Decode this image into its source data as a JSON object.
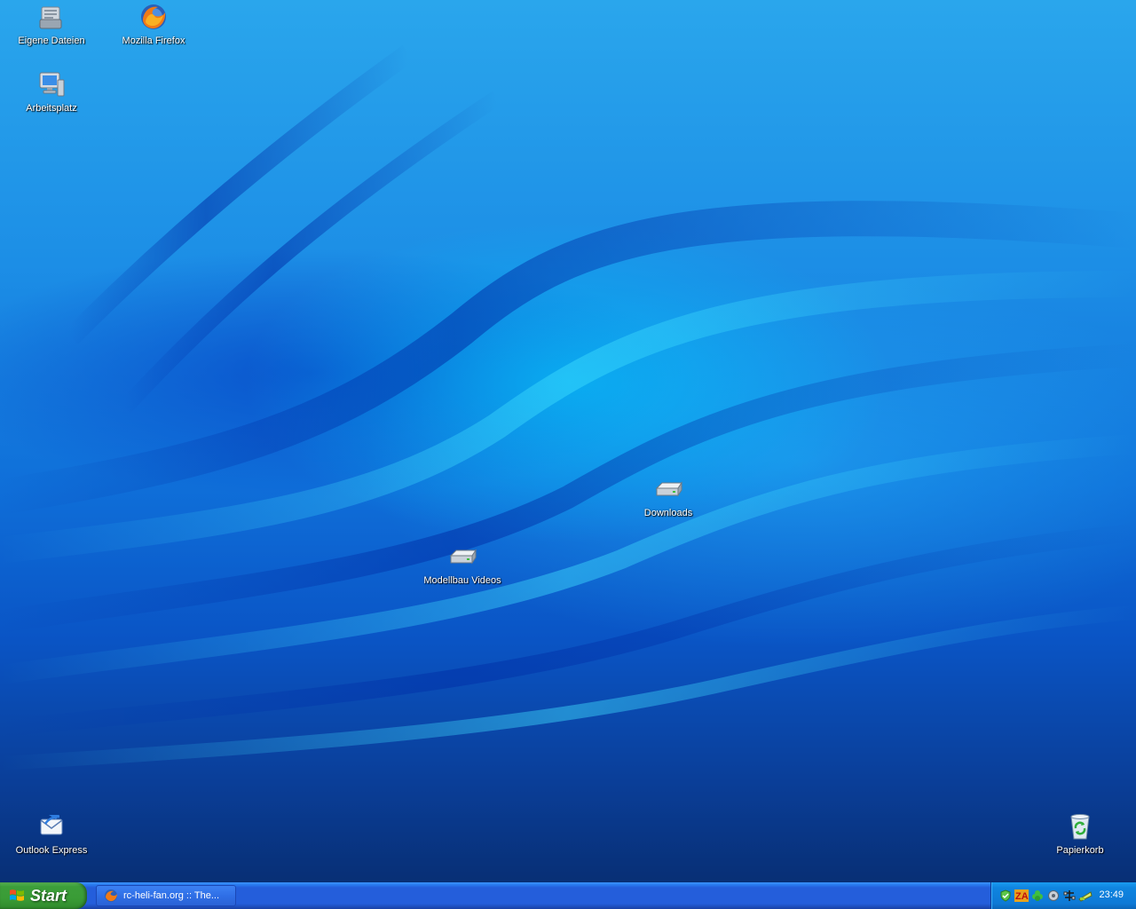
{
  "desktop": {
    "icons": {
      "my_documents": "Eigene Dateien",
      "firefox": "Mozilla Firefox",
      "my_computer": "Arbeitsplatz",
      "downloads": "Downloads",
      "modelbau_videos": "Modellbau Videos",
      "outlook_express": "Outlook Express",
      "recycle_bin": "Papierkorb"
    }
  },
  "taskbar": {
    "start_label": "Start",
    "task_button_label": "rc-heli-fan.org :: The...",
    "tray": {
      "clock": "23:49",
      "icons": [
        "shield-icon",
        "zonealarm-icon",
        "clover-icon",
        "speaker-icon",
        "network-icon",
        "battery-icon"
      ]
    }
  },
  "colors": {
    "taskbar_blue": "#245edb",
    "start_green": "#3a9c36",
    "tray_blue": "#0f85e0"
  }
}
